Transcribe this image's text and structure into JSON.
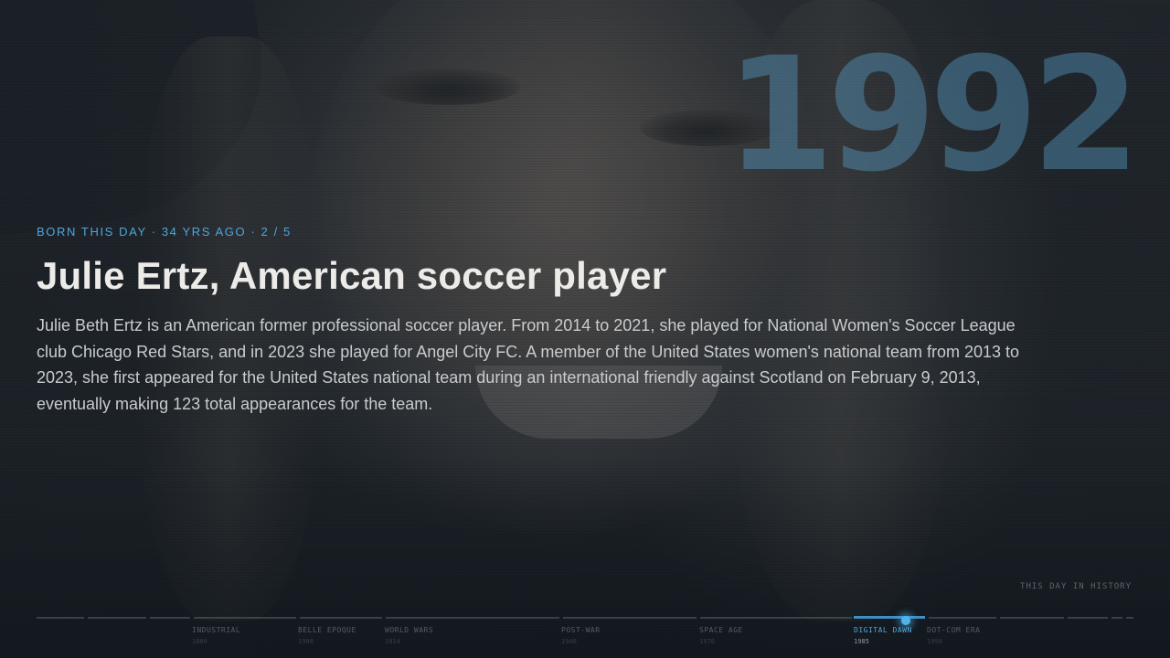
{
  "hero": {
    "year": "1992",
    "eyebrow": "BORN THIS DAY · 34 YRS AGO · 2 / 5",
    "title": "Julie Ertz, American soccer player",
    "summary": "Julie Beth Ertz is an American former professional soccer player. From 2014 to 2021, she played for National Women's Soccer League club Chicago Red Stars, and in 2023 she played for Angel City FC. A member of the United States women's national team from 2013 to 2023, she first appeared for the United States national team during an international friendly against Scotland on February 9, 2013, eventually making 123 total appearances for the team."
  },
  "tag": "THIS DAY IN HISTORY",
  "timeline": {
    "eras": [
      {
        "name": "INDUSTRIAL",
        "year": "1880"
      },
      {
        "name": "BELLE EPOQUE",
        "year": "1900"
      },
      {
        "name": "WORLD WARS",
        "year": "1914"
      },
      {
        "name": "POST-WAR",
        "year": "1946"
      },
      {
        "name": "SPACE AGE",
        "year": "1970"
      },
      {
        "name": "DIGITAL DAWN",
        "year": "1985"
      },
      {
        "name": "DOT-COM ERA",
        "year": "1998"
      }
    ],
    "active_era": "DIGITAL DAWN"
  }
}
